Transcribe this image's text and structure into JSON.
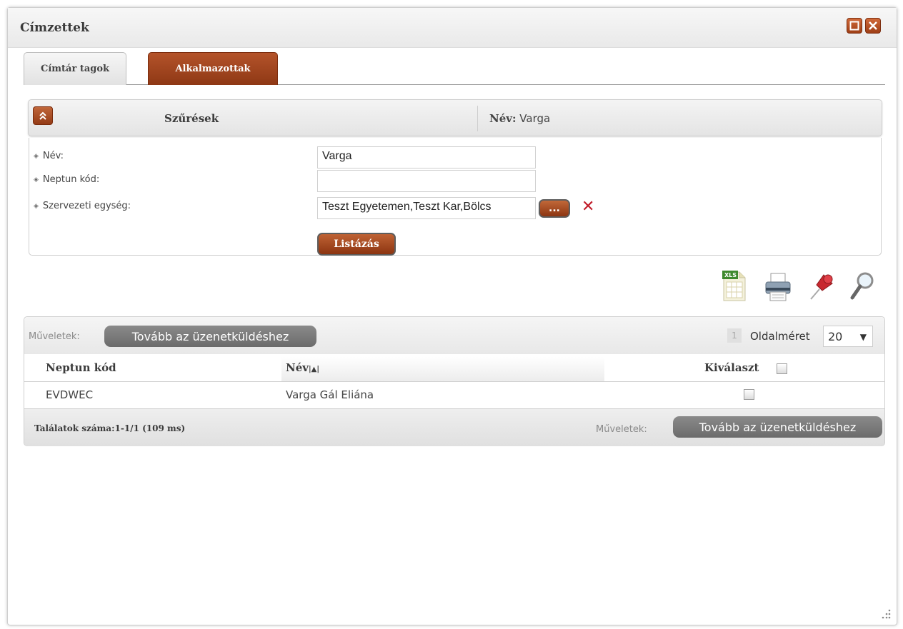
{
  "window": {
    "title": "Címzettek"
  },
  "tabs": [
    {
      "label": "Címtár tagok",
      "active": false
    },
    {
      "label": "Alkalmazottak",
      "active": true
    }
  ],
  "filter": {
    "title": "Szűrések",
    "summary_label": "Név:",
    "summary_value": "Varga",
    "fields": [
      {
        "label": "Név:",
        "value": "Varga"
      },
      {
        "label": "Neptun kód:",
        "value": ""
      },
      {
        "label": "Szervezeti egység:",
        "value": "Teszt Egyetemen,Teszt Kar,Bölcs"
      }
    ],
    "browse_label": "...",
    "clear_label": "✕",
    "list_button": "Listázás"
  },
  "toolbar": {
    "icons": [
      "xls-export-icon",
      "print-icon",
      "pin-icon",
      "search-icon"
    ],
    "xls_text": "XLS"
  },
  "grid": {
    "operations_label": "Műveletek:",
    "action_label": "Tovább az üzenetküldéshez",
    "page_number": "1",
    "page_size_label": "Oldalméret",
    "page_size": "20",
    "columns": [
      "Neptun kód",
      "Név",
      "Kiválaszt"
    ],
    "rows": [
      {
        "neptun": "EVDWEC",
        "name": "Varga Gál Eliána",
        "selected": false
      }
    ],
    "results_text": "Találatok száma:1-1/1 (109 ms)"
  },
  "colors": {
    "accent": "#a2451c",
    "action_button": "#7a7a7a",
    "clear_icon": "#c11d2a"
  }
}
